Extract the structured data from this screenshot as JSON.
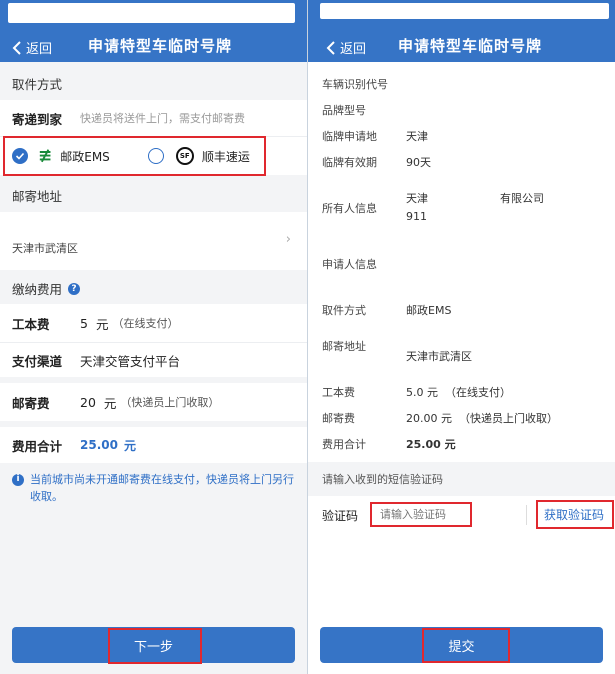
{
  "left": {
    "nav": {
      "back_label": "返回",
      "title": "申请特型车临时号牌"
    },
    "pickup": {
      "section_title": "取件方式",
      "method_label": "寄递到家",
      "method_hint": "快递员将送件上门，需支付邮寄费",
      "option_ems": "邮政EMS",
      "option_sf": "顺丰速运",
      "sf_logo_text": "SF"
    },
    "address": {
      "section_title": "邮寄地址",
      "value": "天津市武清区"
    },
    "fees": {
      "section_title": "缴纳费用",
      "help_glyph": "?",
      "cost_label": "工本费",
      "cost_amount": "5",
      "cost_unit": "元",
      "cost_note": "（在线支付）",
      "channel_label": "支付渠道",
      "channel_value": "天津交管支付平台",
      "postage_label": "邮寄费",
      "postage_amount": "20",
      "postage_unit": "元",
      "postage_note": "（快递员上门收取）",
      "total_label": "费用合计",
      "total_value": "25.00",
      "total_unit": "元"
    },
    "notice_glyph": "i",
    "notice": "当前城市尚未开通邮寄费在线支付，快递员将上门另行收取。",
    "next_button": "下一步"
  },
  "right": {
    "nav": {
      "back_label": "返回",
      "title": "申请特型车临时号牌"
    },
    "info": {
      "vin_label": "车辆识别代号",
      "brand_label": "品牌型号",
      "plate_place_label": "临牌申请地",
      "plate_place_value": "天津",
      "validity_label": "临牌有效期",
      "validity_value": "90天",
      "owner_label": "所有人信息",
      "owner_line1_a": "天津",
      "owner_line1_b": "有限公司",
      "owner_line2": "911",
      "applicant_label": "申请人信息",
      "pickup_label": "取件方式",
      "pickup_value": "邮政EMS",
      "address_label": "邮寄地址",
      "address_value": "天津市武清区",
      "cost_label": "工本费",
      "cost_value": "5.0 元  （在线支付）",
      "postage_label": "邮寄费",
      "postage_value": "20.00 元  （快递员上门收取）",
      "total_label": "费用合计",
      "total_value": "25.00 元"
    },
    "verify": {
      "prompt": "请输入收到的短信验证码",
      "label": "验证码",
      "placeholder": "请输入验证码",
      "get_code_button": "获取验证码"
    },
    "submit_button": "提交"
  }
}
